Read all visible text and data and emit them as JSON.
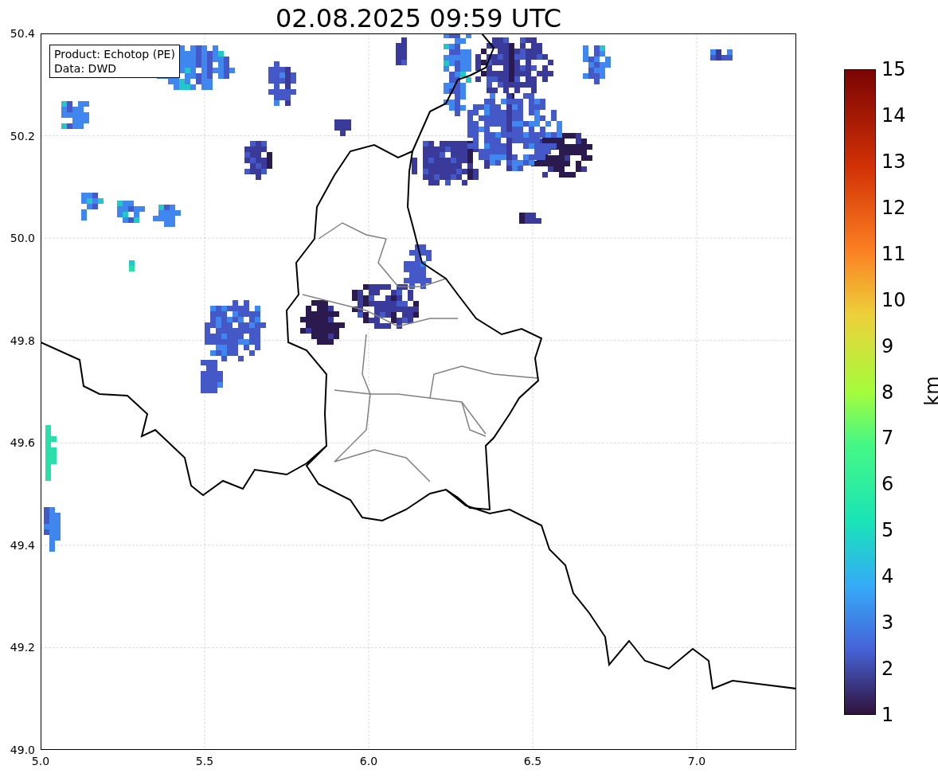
{
  "title": "02.08.2025 09:59 UTC",
  "legend": [
    "Product: Echotop (PE)",
    "Data: DWD"
  ],
  "axes": {
    "xticks": [
      "5.0",
      "5.5",
      "6.0",
      "6.5",
      "7.0"
    ],
    "yticks": [
      "50.4",
      "50.2",
      "50.0",
      "49.8",
      "49.6",
      "49.4",
      "49.2",
      "49.0"
    ]
  },
  "colorbar": {
    "label": "km",
    "ticks": [
      "15",
      "14",
      "13",
      "12",
      "11",
      "10",
      "9",
      "8",
      "7",
      "6",
      "5",
      "4",
      "3",
      "2",
      "1"
    ]
  }
}
